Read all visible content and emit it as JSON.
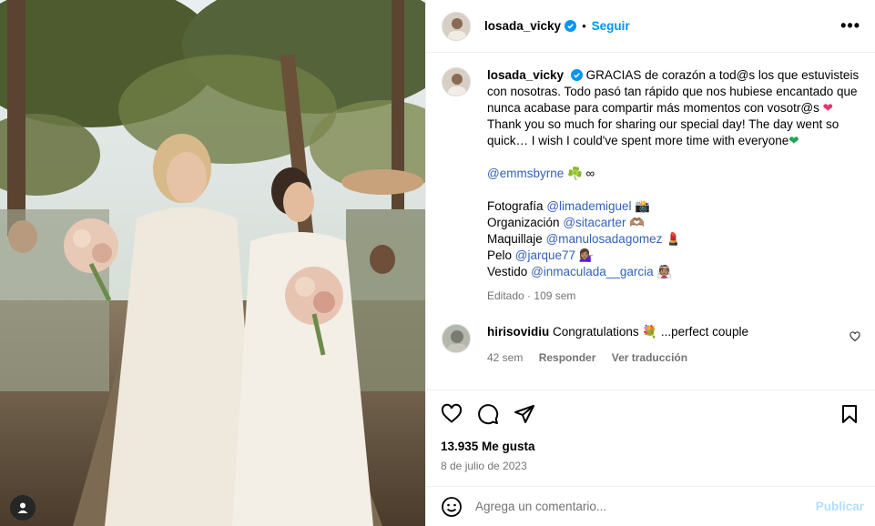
{
  "post": {
    "username": "losada_vicky",
    "follow_label": "Seguir",
    "dot": "•",
    "more_label": "•••"
  },
  "caption": {
    "username": "losada_vicky",
    "line1": "GRACIAS de corazón a tod@s los que estuvisteis con nosotras. Todo pasó tan rápido que nos hubiese encantado que nunca acabase para compartir más momentos con vosotr@s",
    "heart1": "❤",
    "line2": "Thank you so much for sharing our special day! The day went so quick… I wish I could've spent more time with everyone",
    "heart2": "❤",
    "mention": "@emmsbyrne",
    "mention_emoji": "☘️ ∞",
    "credits": [
      {
        "label": "Fotografía",
        "handle": "@limademiguel",
        "emoji": "📸"
      },
      {
        "label": "Organización",
        "handle": "@sitacarter",
        "emoji": "🫶🏽"
      },
      {
        "label": "Maquillaje",
        "handle": "@manulosadagomez",
        "emoji": "💄"
      },
      {
        "label": "Pelo",
        "handle": "@jarque77",
        "emoji": "💁🏽‍♀️"
      },
      {
        "label": "Vestido",
        "handle": "@inmaculada__garcia",
        "emoji": "👰🏽"
      }
    ],
    "edited": "Editado",
    "sep": "·",
    "age": "109 sem"
  },
  "comment": {
    "username": "hirisovidiu",
    "text": "Congratulations 💐 ...perfect couple",
    "age": "42 sem",
    "reply_label": "Responder",
    "translate_label": "Ver traducción"
  },
  "stats": {
    "likes": "13.935 Me gusta",
    "date": "8 de julio de 2023"
  },
  "composer": {
    "placeholder": "Agrega un comentario...",
    "publish_label": "Publicar"
  },
  "colors": {
    "link": "#3461b8",
    "follow": "#0095f6",
    "publish_disabled": "#b2dffc",
    "secondary_text": "#737373"
  }
}
